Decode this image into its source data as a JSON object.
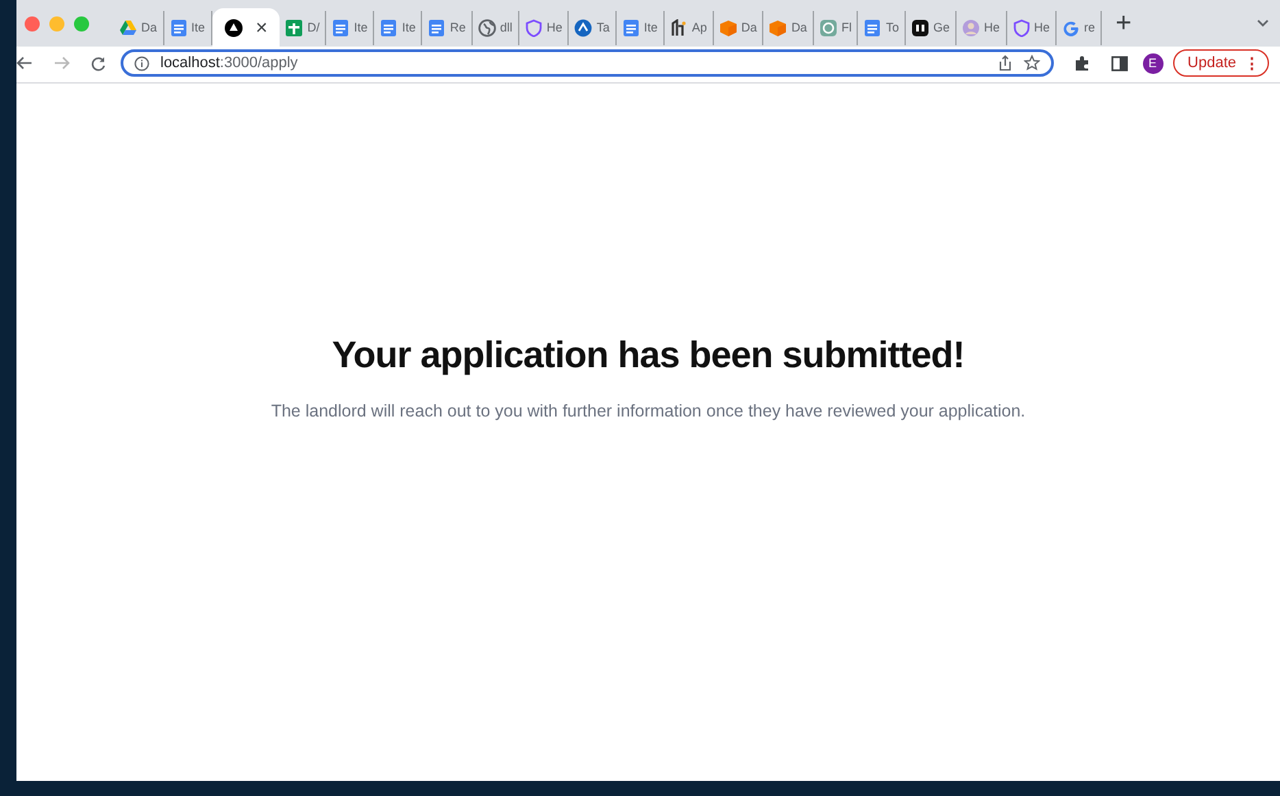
{
  "tabs": [
    {
      "kind": "drive",
      "label": "Da",
      "selected": false
    },
    {
      "kind": "docs",
      "label": "Ite",
      "selected": false
    },
    {
      "kind": "app",
      "close": "×",
      "selected": true
    },
    {
      "kind": "sheets",
      "label": "D/",
      "selected": false
    },
    {
      "kind": "docs",
      "label": "Ite",
      "selected": false
    },
    {
      "kind": "docs",
      "label": "Ite",
      "selected": false
    },
    {
      "kind": "docs",
      "label": "Re",
      "selected": false
    },
    {
      "kind": "globe",
      "label": "dll",
      "selected": false
    },
    {
      "kind": "shield",
      "label": "He",
      "selected": false
    },
    {
      "kind": "bluecircle",
      "label": "Ta",
      "selected": false
    },
    {
      "kind": "docs",
      "label": "Ite",
      "selected": false
    },
    {
      "kind": "mark",
      "label": "Ap",
      "selected": false
    },
    {
      "kind": "box",
      "label": "Da",
      "selected": false
    },
    {
      "kind": "box",
      "label": "Da",
      "selected": false
    },
    {
      "kind": "knot",
      "label": "Fl",
      "selected": false
    },
    {
      "kind": "docs",
      "label": "To",
      "selected": false
    },
    {
      "kind": "ui",
      "label": "Ge",
      "selected": false
    },
    {
      "kind": "avatar",
      "label": "He",
      "selected": false
    },
    {
      "kind": "shield",
      "label": "He",
      "selected": false
    },
    {
      "kind": "google",
      "label": "re",
      "selected": false
    }
  ],
  "new_tab": "+",
  "toolbar": {
    "address_host": "localhost",
    "address_path": ":3000/apply",
    "profile": "E",
    "update": "Update",
    "menu": "⋮"
  },
  "page": {
    "heading": "Your application has been submitted!",
    "message": "The landlord will reach out to you with further information once they have reviewed your application."
  }
}
